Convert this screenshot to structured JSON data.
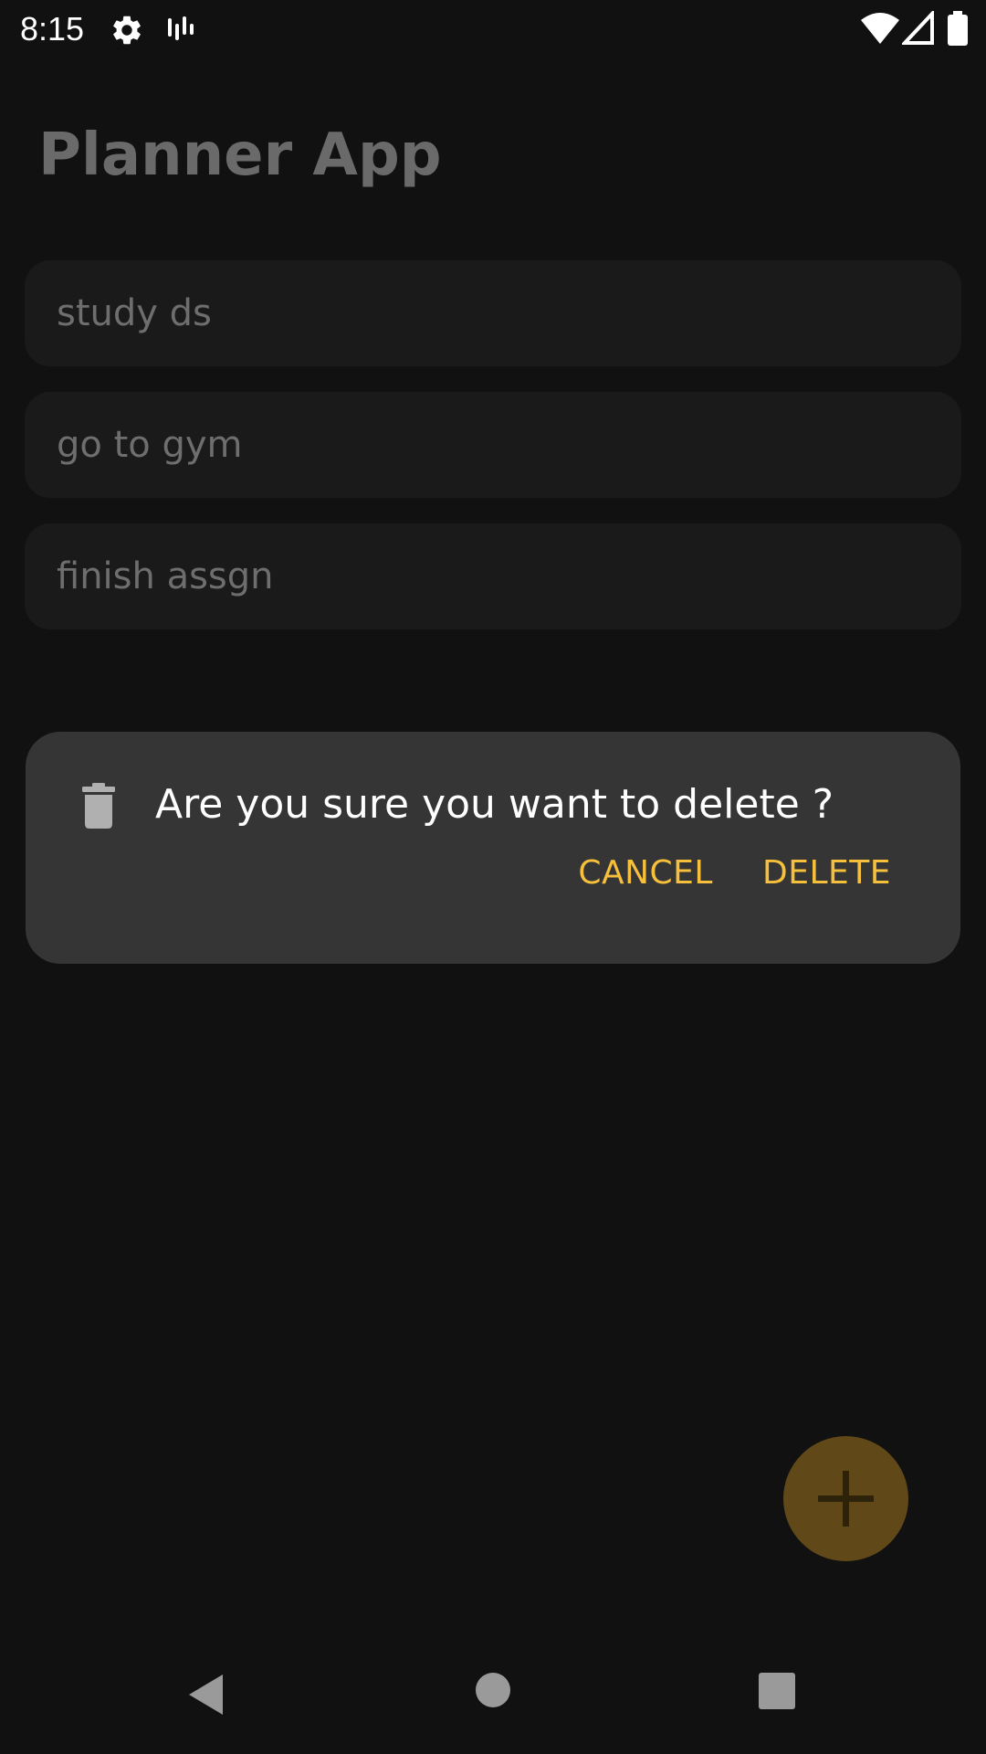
{
  "status_bar": {
    "time": "8:15",
    "icons": [
      "gear-icon",
      "signal-bars-icon",
      "wifi-icon",
      "cell-signal-icon",
      "battery-icon"
    ]
  },
  "app": {
    "title": "Planner App"
  },
  "tasks": [
    {
      "label": "study ds"
    },
    {
      "label": "go to gym"
    },
    {
      "label": "finish assgn"
    }
  ],
  "dialog": {
    "icon": "trash-icon",
    "message": "Are you sure you want to delete ?",
    "cancel_label": "CANCEL",
    "delete_label": "DELETE"
  },
  "fab": {
    "icon": "plus-icon"
  },
  "nav_bar": {
    "icons": [
      "back-icon",
      "home-icon",
      "recents-icon"
    ]
  },
  "colors": {
    "background": "#111111",
    "dialog_bg": "#353535",
    "accent": "#f6c03c",
    "fab_dimmed": "#604818"
  }
}
